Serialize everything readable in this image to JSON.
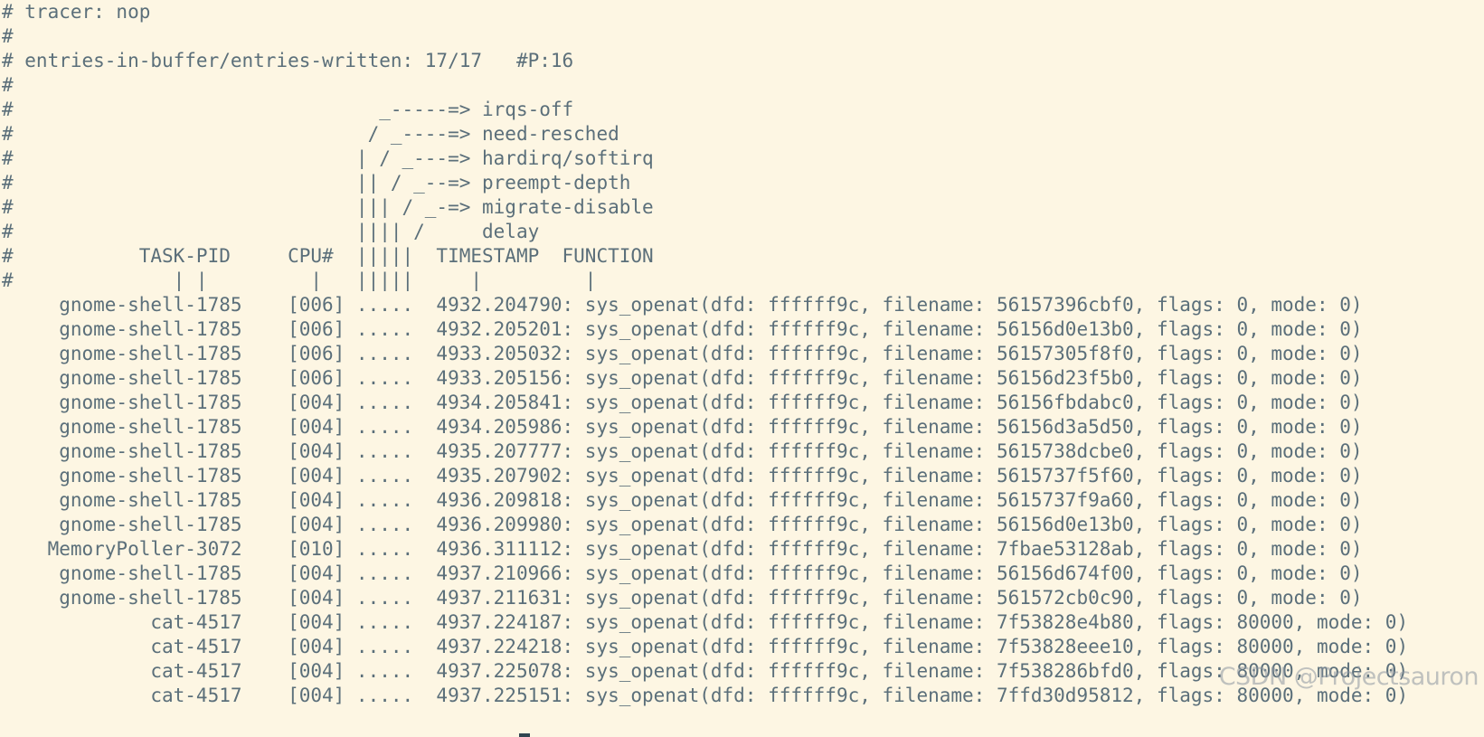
{
  "terminal": {
    "lines": [
      "# tracer: nop",
      "#",
      "# entries-in-buffer/entries-written: 17/17   #P:16",
      "#",
      "#                                _-----=> irqs-off",
      "#                               / _----=> need-resched",
      "#                              | / _---=> hardirq/softirq",
      "#                              || / _--=> preempt-depth",
      "#                              ||| / _-=> migrate-disable",
      "#                              |||| /     delay",
      "#           TASK-PID     CPU#  |||||  TIMESTAMP  FUNCTION",
      "#              | |         |   |||||     |         |",
      "     gnome-shell-1785    [006] .....  4932.204790: sys_openat(dfd: ffffff9c, filename: 56157396cbf0, flags: 0, mode: 0)",
      "     gnome-shell-1785    [006] .....  4932.205201: sys_openat(dfd: ffffff9c, filename: 56156d0e13b0, flags: 0, mode: 0)",
      "     gnome-shell-1785    [006] .....  4933.205032: sys_openat(dfd: ffffff9c, filename: 56157305f8f0, flags: 0, mode: 0)",
      "     gnome-shell-1785    [006] .....  4933.205156: sys_openat(dfd: ffffff9c, filename: 56156d23f5b0, flags: 0, mode: 0)",
      "     gnome-shell-1785    [004] .....  4934.205841: sys_openat(dfd: ffffff9c, filename: 56156fbdabc0, flags: 0, mode: 0)",
      "     gnome-shell-1785    [004] .....  4934.205986: sys_openat(dfd: ffffff9c, filename: 56156d3a5d50, flags: 0, mode: 0)",
      "     gnome-shell-1785    [004] .....  4935.207777: sys_openat(dfd: ffffff9c, filename: 5615738dcbe0, flags: 0, mode: 0)",
      "     gnome-shell-1785    [004] .....  4935.207902: sys_openat(dfd: ffffff9c, filename: 5615737f5f60, flags: 0, mode: 0)",
      "     gnome-shell-1785    [004] .....  4936.209818: sys_openat(dfd: ffffff9c, filename: 5615737f9a60, flags: 0, mode: 0)",
      "     gnome-shell-1785    [004] .....  4936.209980: sys_openat(dfd: ffffff9c, filename: 56156d0e13b0, flags: 0, mode: 0)",
      "    MemoryPoller-3072    [010] .....  4936.311112: sys_openat(dfd: ffffff9c, filename: 7fbae53128ab, flags: 0, mode: 0)",
      "     gnome-shell-1785    [004] .....  4937.210966: sys_openat(dfd: ffffff9c, filename: 56156d674f00, flags: 0, mode: 0)",
      "     gnome-shell-1785    [004] .....  4937.211631: sys_openat(dfd: ffffff9c, filename: 561572cb0c90, flags: 0, mode: 0)",
      "             cat-4517    [004] .....  4937.224187: sys_openat(dfd: ffffff9c, filename: 7f53828e4b80, flags: 80000, mode: 0)",
      "             cat-4517    [004] .....  4937.224218: sys_openat(dfd: ffffff9c, filename: 7f53828eee10, flags: 80000, mode: 0)",
      "             cat-4517    [004] .....  4937.225078: sys_openat(dfd: ffffff9c, filename: 7f538286bfd0, flags: 80000, mode: 0)",
      "             cat-4517    [004] .....  4937.225151: sys_openat(dfd: ffffff9c, filename: 7ffd30d95812, flags: 80000, mode: 0)"
    ],
    "watermark": "CSDN @Projectsauron",
    "colors": {
      "background": "#fdf6e3",
      "foreground": "#5b6f7a",
      "cursor": "#2f4550"
    }
  }
}
